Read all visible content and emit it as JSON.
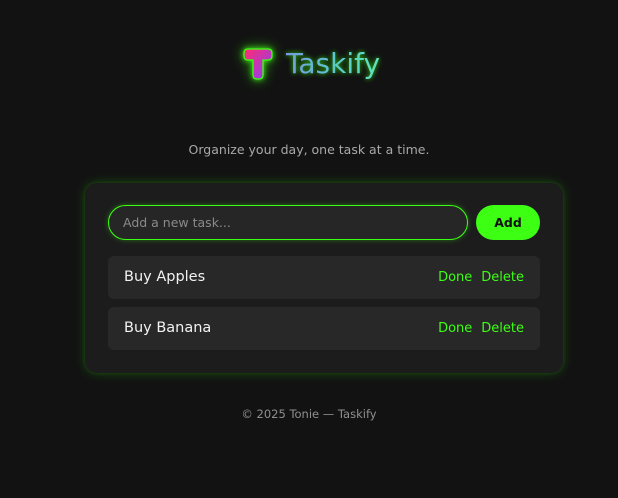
{
  "brand": {
    "title": "Taskify",
    "logo_icon": "gradient-t-logo-icon",
    "accent_color": "#3dff14",
    "logo_gradient": [
      "#ff2d6f",
      "#8a3dff"
    ]
  },
  "tagline": "Organize your day, one task at a time.",
  "new_task": {
    "placeholder": "Add a new task...",
    "value": "",
    "add_label": "Add"
  },
  "tasks": [
    {
      "text": "Buy Apples",
      "done_label": "Done",
      "delete_label": "Delete"
    },
    {
      "text": "Buy Banana",
      "done_label": "Done",
      "delete_label": "Delete"
    }
  ],
  "footer": "© 2025 Tonie — Taskify"
}
